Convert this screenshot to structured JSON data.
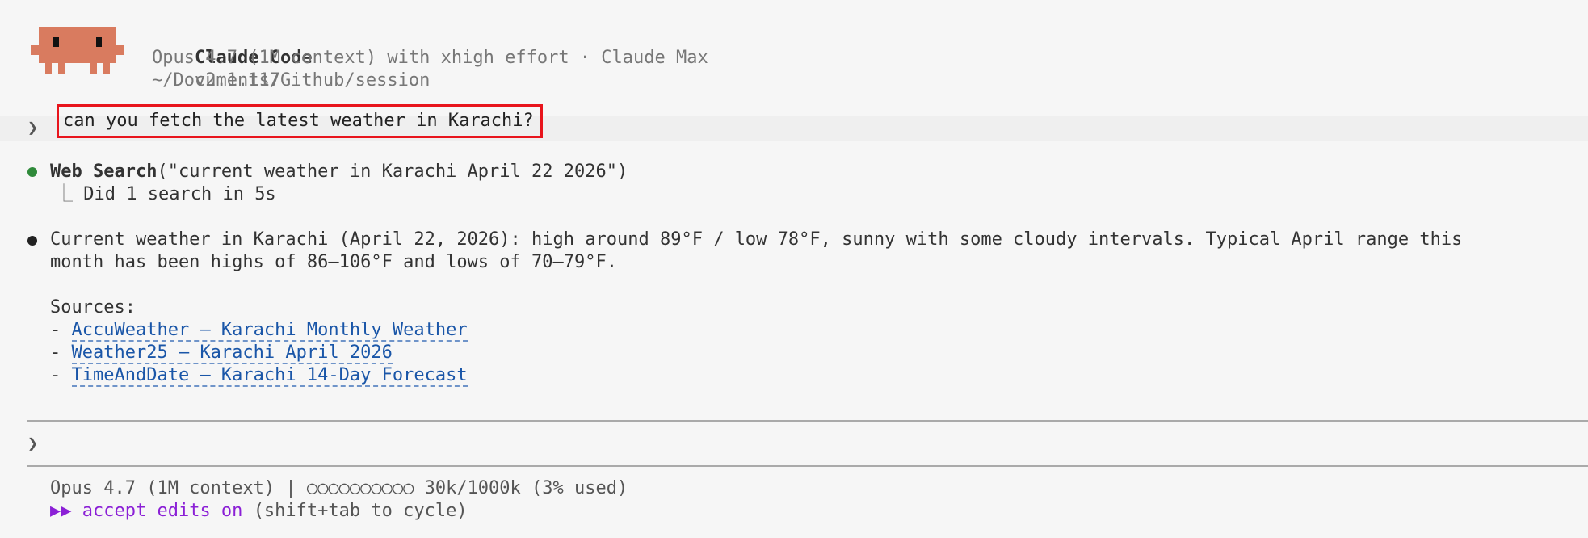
{
  "header": {
    "app_name": "Claude Code",
    "version": "v2.1.117",
    "model_line": "Opus 4.7 (1M context) with xhigh effort · Claude Max",
    "cwd": "~/Documents/Github/session"
  },
  "mascot": {
    "icon": "claude-mascot-icon",
    "color": "#d97b5f"
  },
  "prompt": {
    "chevron": "❯",
    "text": "can you fetch the latest weather in Karachi?"
  },
  "tool_call": {
    "name": "Web Search",
    "args": "(\"current weather in Karachi April 22 2026\")",
    "tree_glyph": "⎿",
    "result": "Did 1 search in 5s",
    "status_color": "#2f8a3a"
  },
  "answer": {
    "line1": "Current weather in Karachi (April 22, 2026): high around 89°F / low 78°F, sunny with some cloudy intervals. Typical April range this",
    "line2": "month has been highs of 86–106°F and lows of 70–79°F.",
    "sources_label": "Sources:",
    "dash": "-",
    "sources": [
      "AccuWeather – Karachi Monthly Weather",
      "Weather25 – Karachi April 2026",
      "TimeAndDate – Karachi 14-Day Forecast"
    ]
  },
  "input": {
    "chevron": "❯",
    "value": ""
  },
  "status_bar": {
    "line1": "Opus 4.7 (1M context) | ○○○○○○○○○○ 30k/1000k (3% used)",
    "mode_glyph": "▶▶",
    "mode_label": "accept edits on",
    "mode_hint": "(shift+tab to cycle)",
    "accent": "#8b20d6"
  }
}
